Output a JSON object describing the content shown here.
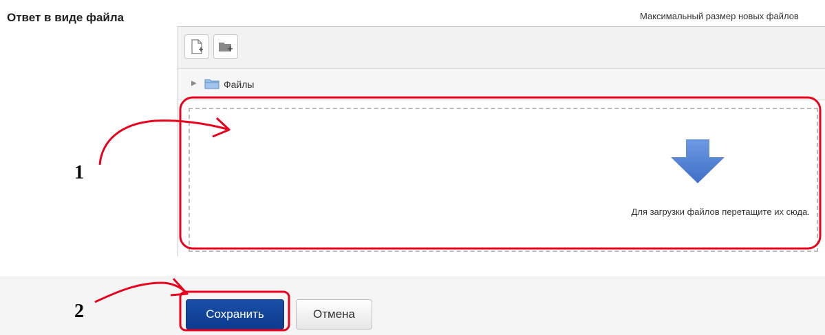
{
  "form": {
    "field_label": "Ответ в виде файла",
    "max_size_text": "Максимальный размер новых файлов"
  },
  "filemanager": {
    "toolbar": {
      "add_file_icon": "add-file-icon",
      "create_folder_icon": "create-folder-icon"
    },
    "path": {
      "arrow_icon": "triangle-right-icon",
      "folder_icon": "folder-icon",
      "label": "Файлы"
    },
    "droparea": {
      "arrow_icon": "download-arrow-icon",
      "text": "Для загрузки файлов перетащите их сюда."
    }
  },
  "actions": {
    "save_label": "Сохранить",
    "cancel_label": "Отмена"
  },
  "annotations": {
    "marker_1": "1",
    "marker_2": "2"
  },
  "colors": {
    "accent_blue": "#0c3a8e",
    "highlight_red": "#e8001c",
    "arrow_blue": "#4b7ed6"
  }
}
